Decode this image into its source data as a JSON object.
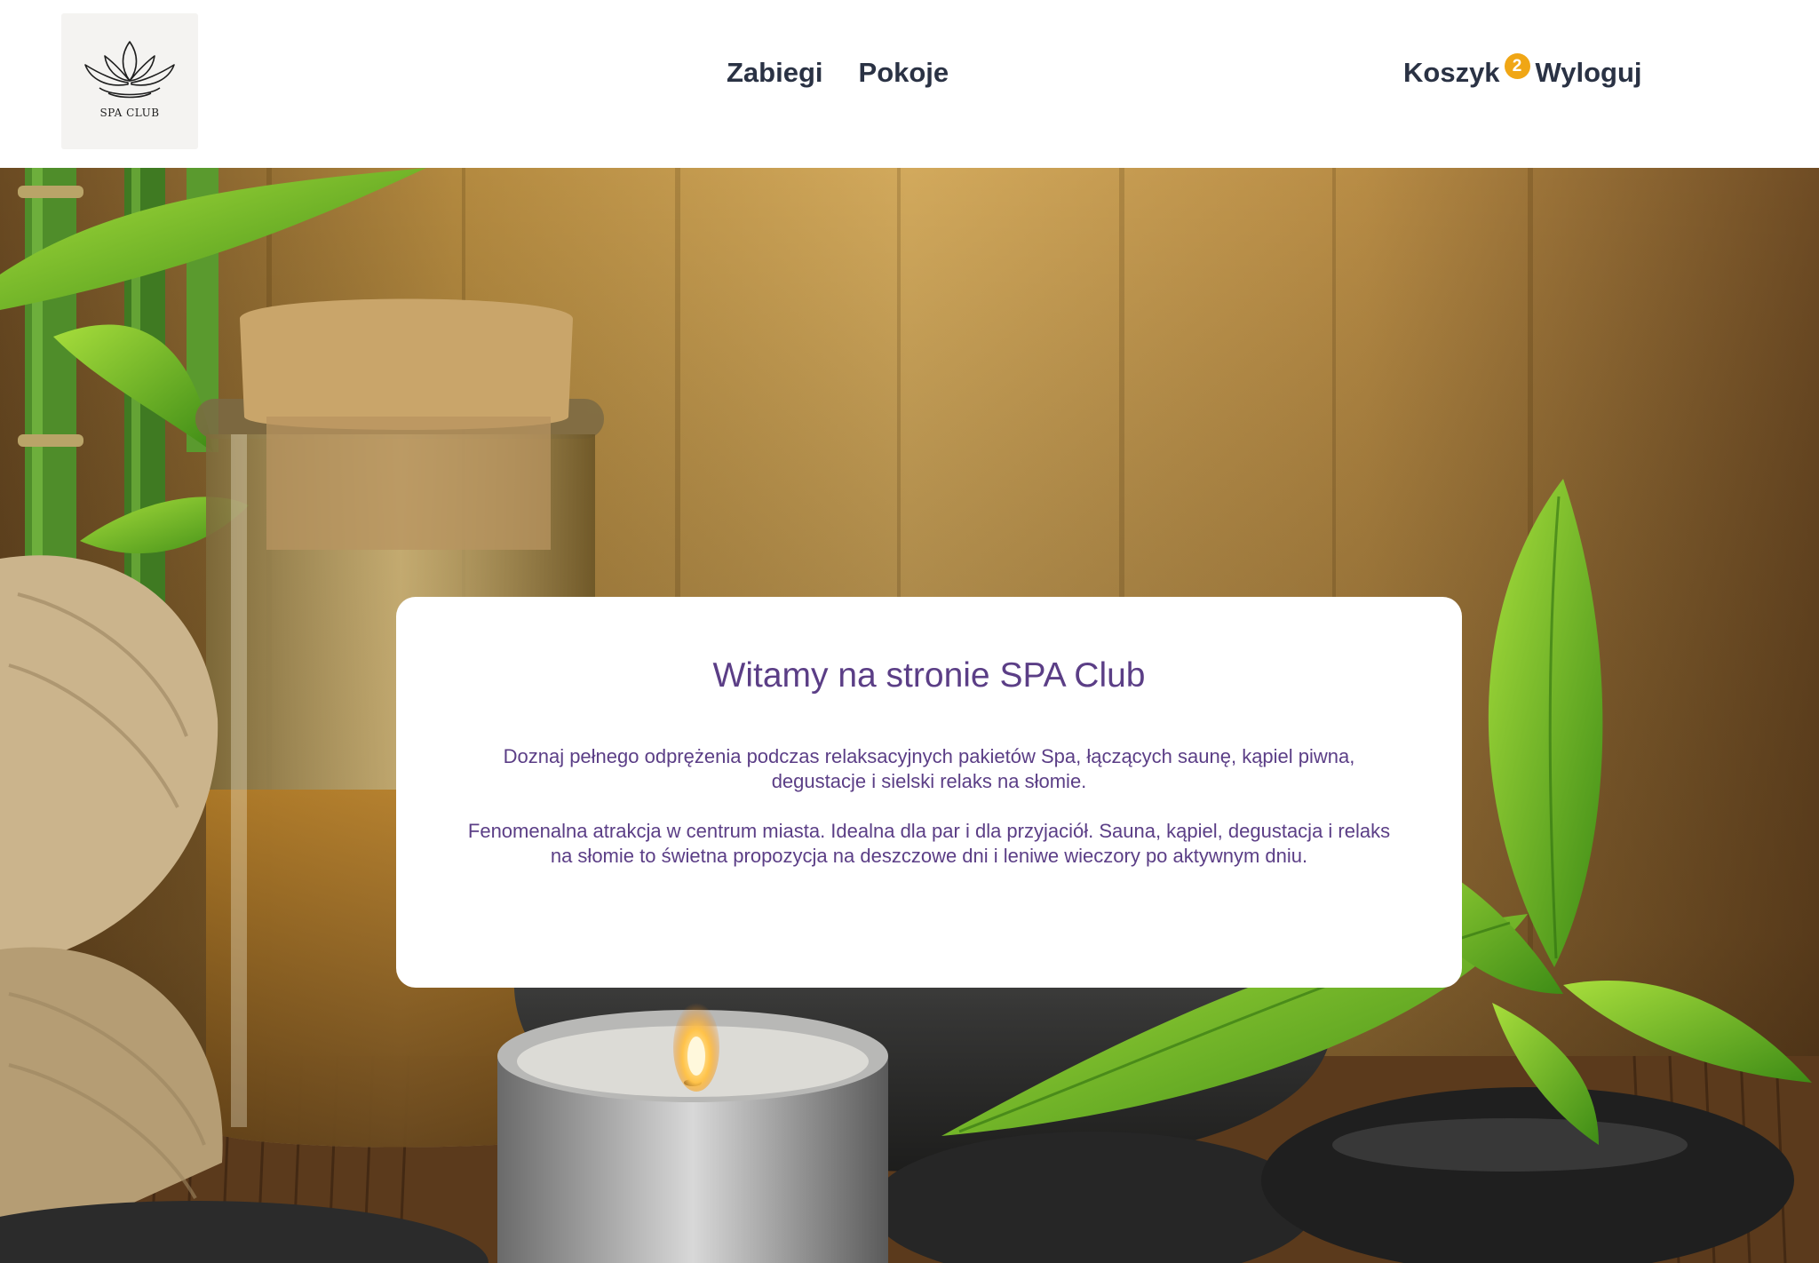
{
  "header": {
    "logo_text": "SPA CLUB",
    "nav": [
      {
        "label": "Zabiegi"
      },
      {
        "label": "Pokoje"
      }
    ],
    "cart": {
      "label": "Koszyk",
      "count": "2"
    },
    "logout_label": "Wyloguj"
  },
  "welcome": {
    "title": "Witamy na stronie SPA Club",
    "paragraph1": "Doznaj pełnego odprężenia podczas relaksacyjnych pakietów Spa, łączących saunę, kąpiel piwna, degustacje i sielski relaks na słomie.",
    "paragraph2": "Fenomenalna atrakcja w centrum miasta. Idealna dla par i dla przyjaciół. Sauna, kąpiel, degustacja i relaks na słomie to świetna propozycja na deszczowe dni i leniwe wieczory po aktywnym dniu."
  },
  "colors": {
    "nav_text": "#2a3244",
    "card_text": "#5b3e86",
    "badge": "#f0a615"
  },
  "icons": {
    "logo": "lotus-icon"
  }
}
